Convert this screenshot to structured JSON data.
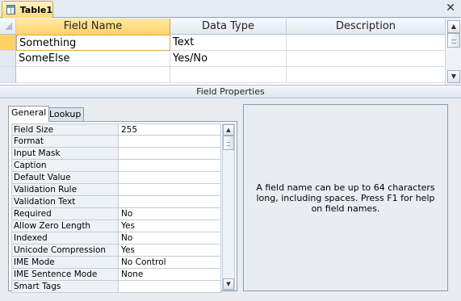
{
  "tab": {
    "title": "Table1",
    "close_glyph": "✕"
  },
  "grid": {
    "columns": [
      "Field Name",
      "Data Type",
      "Description"
    ],
    "rows": [
      {
        "field": "Something",
        "type": "Text",
        "description": ""
      },
      {
        "field": "SomeElse",
        "type": "Yes/No",
        "description": ""
      },
      {
        "field": "",
        "type": "",
        "description": ""
      }
    ],
    "scroll_up": "▲",
    "scroll_down": "▼"
  },
  "field_properties": {
    "title": "Field Properties",
    "tabs": [
      "General",
      "Lookup"
    ],
    "properties": [
      {
        "label": "Field Size",
        "value": "255"
      },
      {
        "label": "Format",
        "value": ""
      },
      {
        "label": "Input Mask",
        "value": ""
      },
      {
        "label": "Caption",
        "value": ""
      },
      {
        "label": "Default Value",
        "value": ""
      },
      {
        "label": "Validation Rule",
        "value": ""
      },
      {
        "label": "Validation Text",
        "value": ""
      },
      {
        "label": "Required",
        "value": "No"
      },
      {
        "label": "Allow Zero Length",
        "value": "Yes"
      },
      {
        "label": "Indexed",
        "value": "No"
      },
      {
        "label": "Unicode Compression",
        "value": "Yes"
      },
      {
        "label": "IME Mode",
        "value": "No Control"
      },
      {
        "label": "IME Sentence Mode",
        "value": "None"
      },
      {
        "label": "Smart Tags",
        "value": ""
      }
    ],
    "help_text": "A field name can be up to 64 characters long, including spaces. Press F1 for help on field names."
  }
}
